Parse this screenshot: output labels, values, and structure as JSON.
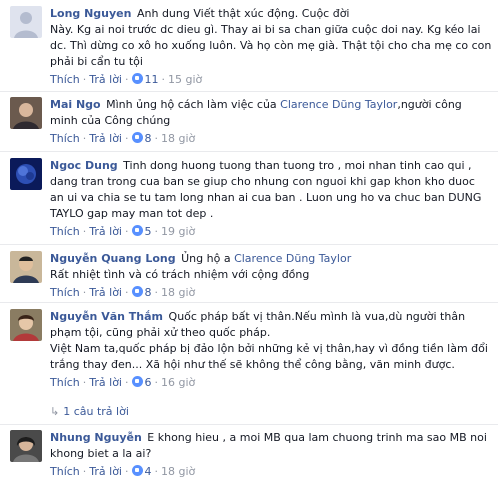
{
  "comments": [
    {
      "author": "Long Nguyen",
      "text_parts": [
        "Anh dung Viết thật xúc động. Cuộc đời",
        "Này. Kg ai noi trước dc dieu gì. Thay ai bi sa chan giữa cuộc doi nay. Kg kéo lai",
        "dc. Thì dừng co xô ho xuống luôn. Và họ còn mẹ già. Thật tội cho cha mẹ co con",
        "phải bi cẩn tu tội"
      ],
      "like_label": "Thích",
      "reply_label": "Trả lời",
      "likes": "11",
      "time": "15 giờ"
    },
    {
      "author": "Mai Ngo",
      "text_before": "Mình ủng hộ cách làm việc của ",
      "mention": "Clarence Dũng Taylor",
      "text_after": ",người công minh của Công chúng",
      "like_label": "Thích",
      "reply_label": "Trả lời",
      "likes": "8",
      "time": "18 giờ"
    },
    {
      "author": "Ngoc Dung",
      "text": "Tinh dong huong tuong than tuong tro , moi nhan tinh cao qui , dang tran trong cua ban se giup cho nhung con nguoi khi gap khon kho duoc an ui va chia se tu tam long nhan ai cua ban . Luon ung ho va chuc ban DUNG TAYLO gap may man tot dep .",
      "like_label": "Thích",
      "reply_label": "Trả lời",
      "likes": "5",
      "time": "19 giờ"
    },
    {
      "author": "Nguyễn Quang Long",
      "text_before": "Ủng hộ a ",
      "mention": "Clarence Dũng Taylor",
      "text_line2": "Rất nhiệt tình và có trách nhiệm với cộng đồng",
      "like_label": "Thích",
      "reply_label": "Trả lời",
      "likes": "8",
      "time": "18 giờ"
    },
    {
      "author": "Nguyễn Văn Thắm",
      "text_line1": "Quốc pháp bất vị thân.Nếu mình là vua,dù người thân phạm tội, cũng phải xử theo quốc pháp.",
      "text_line2": "Việt Nam ta,quốc pháp bị đảo lộn bởi những kẻ vị thân,hay vì đồng tiền làm đổi trắng thay đen... Xã hội như thế sẽ không thể công bằng, văn minh được.",
      "like_label": "Thích",
      "reply_label": "Trả lời",
      "likes": "6",
      "time": "16 giờ",
      "replies_label": "1 câu trả lời"
    },
    {
      "author": "Nhung Nguyễn",
      "text": "E khong hieu , a moi MB qua lam chuong trinh ma sao MB noi khong biet a la ai?",
      "like_label": "Thích",
      "reply_label": "Trả lời",
      "likes": "4",
      "time": "18 giờ"
    }
  ],
  "colors": {
    "link": "#3b5998",
    "meta": "#9197a3",
    "text": "#141823",
    "like_badge": "#5890ff"
  },
  "icons": {
    "like": "like-thumb-icon",
    "reply_arrow": "reply-arrow-icon"
  }
}
